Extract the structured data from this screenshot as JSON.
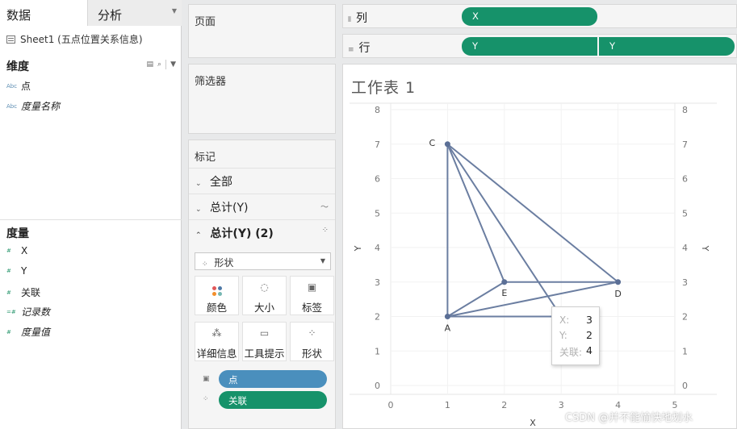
{
  "left": {
    "tab_data": "数据",
    "tab_analysis": "分析",
    "datasource": "Sheet1 (五点位置关系信息)",
    "dimensions_header": "维度",
    "dimensions": [
      {
        "icon": "Abc",
        "label": "点"
      },
      {
        "icon": "Abc",
        "label": "度量名称"
      }
    ],
    "measures_header": "度量",
    "measures": [
      {
        "icon": "#",
        "label": "X"
      },
      {
        "icon": "#",
        "label": "Y"
      },
      {
        "icon": "#",
        "label": "关联"
      },
      {
        "icon": "=#",
        "label": "记录数"
      },
      {
        "icon": "#",
        "label": "度量值"
      }
    ]
  },
  "cards": {
    "pages": "页面",
    "filters": "筛选器",
    "marks": "标记"
  },
  "marks": {
    "rows": [
      {
        "label": "全部"
      },
      {
        "label": "总计(Y)"
      },
      {
        "label": "总计(Y) (2)"
      }
    ],
    "mark_type": "形状",
    "buttons": [
      "颜色",
      "大小",
      "标签",
      "详细信息",
      "工具提示",
      "形状"
    ],
    "pill_point": "点",
    "pill_relation": "关联"
  },
  "shelves": {
    "columns_label": "列",
    "rows_label": "行",
    "columns_pills": [
      "X"
    ],
    "rows_pills": [
      "Y",
      "Y"
    ]
  },
  "sheet": {
    "title": "工作表 1"
  },
  "chart_data": {
    "type": "line",
    "xlabel": "X",
    "ylabel": "Y",
    "xlim": [
      0,
      5
    ],
    "ylim": [
      0,
      8
    ],
    "x_ticks": [
      0,
      1,
      2,
      3,
      4,
      5
    ],
    "y_ticks": [
      0,
      1,
      2,
      3,
      4,
      5,
      6,
      7,
      8
    ],
    "dual_axis": true,
    "grid": true,
    "line_color": "#6b7ea1",
    "points": [
      {
        "label": "A",
        "x": 1,
        "y": 2
      },
      {
        "label": "C",
        "x": 1,
        "y": 7
      },
      {
        "label": "E",
        "x": 2,
        "y": 3
      },
      {
        "label": "D",
        "x": 4,
        "y": 3
      }
    ],
    "segments": [
      [
        "A",
        "C"
      ],
      [
        "C",
        "E"
      ],
      [
        "C",
        "D"
      ],
      [
        "E",
        "D"
      ],
      [
        "A",
        "E"
      ],
      [
        "A",
        "D"
      ],
      [
        {
          "x": 1,
          "y": 2
        },
        {
          "x": 3,
          "y": 2
        }
      ],
      [
        {
          "x": 1,
          "y": 7
        },
        {
          "x": 2.9,
          "y": 2.25
        }
      ]
    ]
  },
  "tooltip": {
    "rows": [
      {
        "key": "X:",
        "value": "3"
      },
      {
        "key": "Y:",
        "value": "2"
      },
      {
        "key": "关联:",
        "value": "4"
      }
    ]
  },
  "watermark": "CSDN @并不能愉快地划水"
}
